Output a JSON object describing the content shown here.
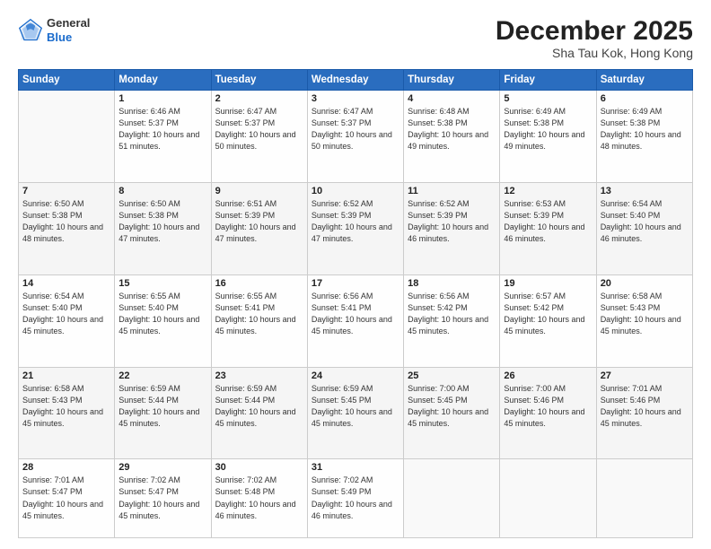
{
  "header": {
    "logo_line1": "General",
    "logo_line2": "Blue",
    "month": "December 2025",
    "location": "Sha Tau Kok, Hong Kong"
  },
  "weekdays": [
    "Sunday",
    "Monday",
    "Tuesday",
    "Wednesday",
    "Thursday",
    "Friday",
    "Saturday"
  ],
  "weeks": [
    [
      {
        "day": "",
        "sunrise": "",
        "sunset": "",
        "daylight": ""
      },
      {
        "day": "1",
        "sunrise": "6:46 AM",
        "sunset": "5:37 PM",
        "daylight": "10 hours and 51 minutes."
      },
      {
        "day": "2",
        "sunrise": "6:47 AM",
        "sunset": "5:37 PM",
        "daylight": "10 hours and 50 minutes."
      },
      {
        "day": "3",
        "sunrise": "6:47 AM",
        "sunset": "5:37 PM",
        "daylight": "10 hours and 50 minutes."
      },
      {
        "day": "4",
        "sunrise": "6:48 AM",
        "sunset": "5:38 PM",
        "daylight": "10 hours and 49 minutes."
      },
      {
        "day": "5",
        "sunrise": "6:49 AM",
        "sunset": "5:38 PM",
        "daylight": "10 hours and 49 minutes."
      },
      {
        "day": "6",
        "sunrise": "6:49 AM",
        "sunset": "5:38 PM",
        "daylight": "10 hours and 48 minutes."
      }
    ],
    [
      {
        "day": "7",
        "sunrise": "6:50 AM",
        "sunset": "5:38 PM",
        "daylight": "10 hours and 48 minutes."
      },
      {
        "day": "8",
        "sunrise": "6:50 AM",
        "sunset": "5:38 PM",
        "daylight": "10 hours and 47 minutes."
      },
      {
        "day": "9",
        "sunrise": "6:51 AM",
        "sunset": "5:39 PM",
        "daylight": "10 hours and 47 minutes."
      },
      {
        "day": "10",
        "sunrise": "6:52 AM",
        "sunset": "5:39 PM",
        "daylight": "10 hours and 47 minutes."
      },
      {
        "day": "11",
        "sunrise": "6:52 AM",
        "sunset": "5:39 PM",
        "daylight": "10 hours and 46 minutes."
      },
      {
        "day": "12",
        "sunrise": "6:53 AM",
        "sunset": "5:39 PM",
        "daylight": "10 hours and 46 minutes."
      },
      {
        "day": "13",
        "sunrise": "6:54 AM",
        "sunset": "5:40 PM",
        "daylight": "10 hours and 46 minutes."
      }
    ],
    [
      {
        "day": "14",
        "sunrise": "6:54 AM",
        "sunset": "5:40 PM",
        "daylight": "10 hours and 45 minutes."
      },
      {
        "day": "15",
        "sunrise": "6:55 AM",
        "sunset": "5:40 PM",
        "daylight": "10 hours and 45 minutes."
      },
      {
        "day": "16",
        "sunrise": "6:55 AM",
        "sunset": "5:41 PM",
        "daylight": "10 hours and 45 minutes."
      },
      {
        "day": "17",
        "sunrise": "6:56 AM",
        "sunset": "5:41 PM",
        "daylight": "10 hours and 45 minutes."
      },
      {
        "day": "18",
        "sunrise": "6:56 AM",
        "sunset": "5:42 PM",
        "daylight": "10 hours and 45 minutes."
      },
      {
        "day": "19",
        "sunrise": "6:57 AM",
        "sunset": "5:42 PM",
        "daylight": "10 hours and 45 minutes."
      },
      {
        "day": "20",
        "sunrise": "6:58 AM",
        "sunset": "5:43 PM",
        "daylight": "10 hours and 45 minutes."
      }
    ],
    [
      {
        "day": "21",
        "sunrise": "6:58 AM",
        "sunset": "5:43 PM",
        "daylight": "10 hours and 45 minutes."
      },
      {
        "day": "22",
        "sunrise": "6:59 AM",
        "sunset": "5:44 PM",
        "daylight": "10 hours and 45 minutes."
      },
      {
        "day": "23",
        "sunrise": "6:59 AM",
        "sunset": "5:44 PM",
        "daylight": "10 hours and 45 minutes."
      },
      {
        "day": "24",
        "sunrise": "6:59 AM",
        "sunset": "5:45 PM",
        "daylight": "10 hours and 45 minutes."
      },
      {
        "day": "25",
        "sunrise": "7:00 AM",
        "sunset": "5:45 PM",
        "daylight": "10 hours and 45 minutes."
      },
      {
        "day": "26",
        "sunrise": "7:00 AM",
        "sunset": "5:46 PM",
        "daylight": "10 hours and 45 minutes."
      },
      {
        "day": "27",
        "sunrise": "7:01 AM",
        "sunset": "5:46 PM",
        "daylight": "10 hours and 45 minutes."
      }
    ],
    [
      {
        "day": "28",
        "sunrise": "7:01 AM",
        "sunset": "5:47 PM",
        "daylight": "10 hours and 45 minutes."
      },
      {
        "day": "29",
        "sunrise": "7:02 AM",
        "sunset": "5:47 PM",
        "daylight": "10 hours and 45 minutes."
      },
      {
        "day": "30",
        "sunrise": "7:02 AM",
        "sunset": "5:48 PM",
        "daylight": "10 hours and 46 minutes."
      },
      {
        "day": "31",
        "sunrise": "7:02 AM",
        "sunset": "5:49 PM",
        "daylight": "10 hours and 46 minutes."
      },
      {
        "day": "",
        "sunrise": "",
        "sunset": "",
        "daylight": ""
      },
      {
        "day": "",
        "sunrise": "",
        "sunset": "",
        "daylight": ""
      },
      {
        "day": "",
        "sunrise": "",
        "sunset": "",
        "daylight": ""
      }
    ]
  ]
}
